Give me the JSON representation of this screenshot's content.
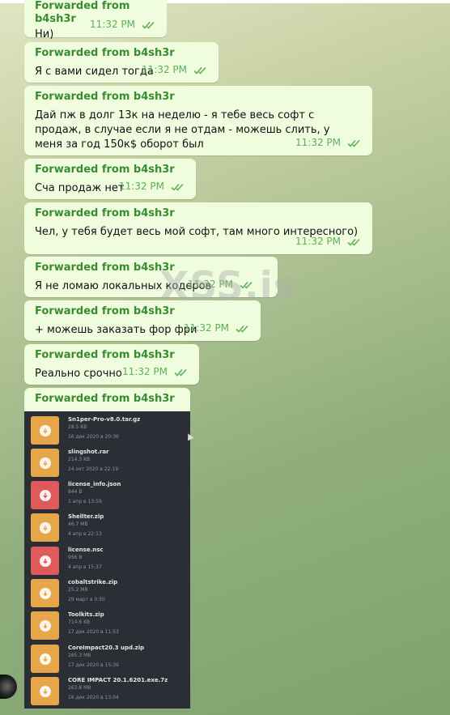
{
  "messages": [
    {
      "sender": "Forwarded from b4sh3r",
      "text": "Ни)",
      "time": "11:32 PM"
    },
    {
      "sender": "Forwarded from b4sh3r",
      "text": "Я с вами сидел тогда",
      "time": "11:32 PM"
    },
    {
      "sender": "Forwarded from b4sh3r",
      "text": "Дай пж в долг 13к на неделю - я тебе весь софт с продаж, в случае если я не отдам - можешь слить, у меня за год 150к$ оборот был",
      "time": "11:32 PM"
    },
    {
      "sender": "Forwarded from b4sh3r",
      "text": "Сча продаж нет",
      "time": "11:32 PM"
    },
    {
      "sender": "Forwarded from b4sh3r",
      "text": "Чел, у тебя будет весь мой софт, там много интересного)",
      "time": "11:32 PM"
    },
    {
      "sender": "Forwarded from b4sh3r",
      "text": "Я не ломаю локальных кодеров",
      "time": "11:32 PM"
    },
    {
      "sender": "Forwarded from b4sh3r",
      "text": "+ можешь заказать фор фри",
      "time": "11:32 PM"
    },
    {
      "sender": "Forwarded from b4sh3r",
      "text": "Реально срочно",
      "time": "11:32 PM"
    },
    {
      "sender": "Forwarded from b4sh3r"
    }
  ],
  "watermark": "XSS.is",
  "files": [
    {
      "name": "Sn1per-Pro-v8.0.tar.gz",
      "size": "28.5 KB",
      "date": "16 дек 2020 в 20:36",
      "color": "#e8a64a"
    },
    {
      "name": "slingshot.rar",
      "size": "214.3 KB",
      "date": "24 окт 2020 в 22:19",
      "color": "#e8a64a"
    },
    {
      "name": "license_info.json",
      "size": "844 B",
      "date": "1 апр в 13:59",
      "color": "#df5b5b"
    },
    {
      "name": "Shellter.zip",
      "size": "46.7 MB",
      "date": "4 апр в 22:13",
      "color": "#e8a64a"
    },
    {
      "name": "license.nsc",
      "size": "956 B",
      "date": "4 апр в 15:37",
      "color": "#df5b5b"
    },
    {
      "name": "cobaltstrike.zip",
      "size": "25.2 MB",
      "date": "29 март в 0:50",
      "color": "#e8a64a"
    },
    {
      "name": "Toolkits.zip",
      "size": "714.6 KB",
      "date": "17 дек 2020 в 11:53",
      "color": "#e8a64a"
    },
    {
      "name": "CoreImpact20.3 upd.zip",
      "size": "265.3 MB",
      "date": "17 дек 2020 в 15:39",
      "color": "#e8a64a"
    },
    {
      "name": "CORE IMPACT 20.1.6201.exe.7z",
      "size": "263.8 MB",
      "date": "16 дек 2020 в 13:04",
      "color": "#e8a64a"
    }
  ],
  "colors": {
    "bubble": "#effdde",
    "sender": "#3a8b31",
    "time": "#5fae5a",
    "panel": "#2b2e35"
  },
  "icons": {
    "read_status": "double-check-icon",
    "file": "download-icon",
    "avatar": "avatar"
  }
}
